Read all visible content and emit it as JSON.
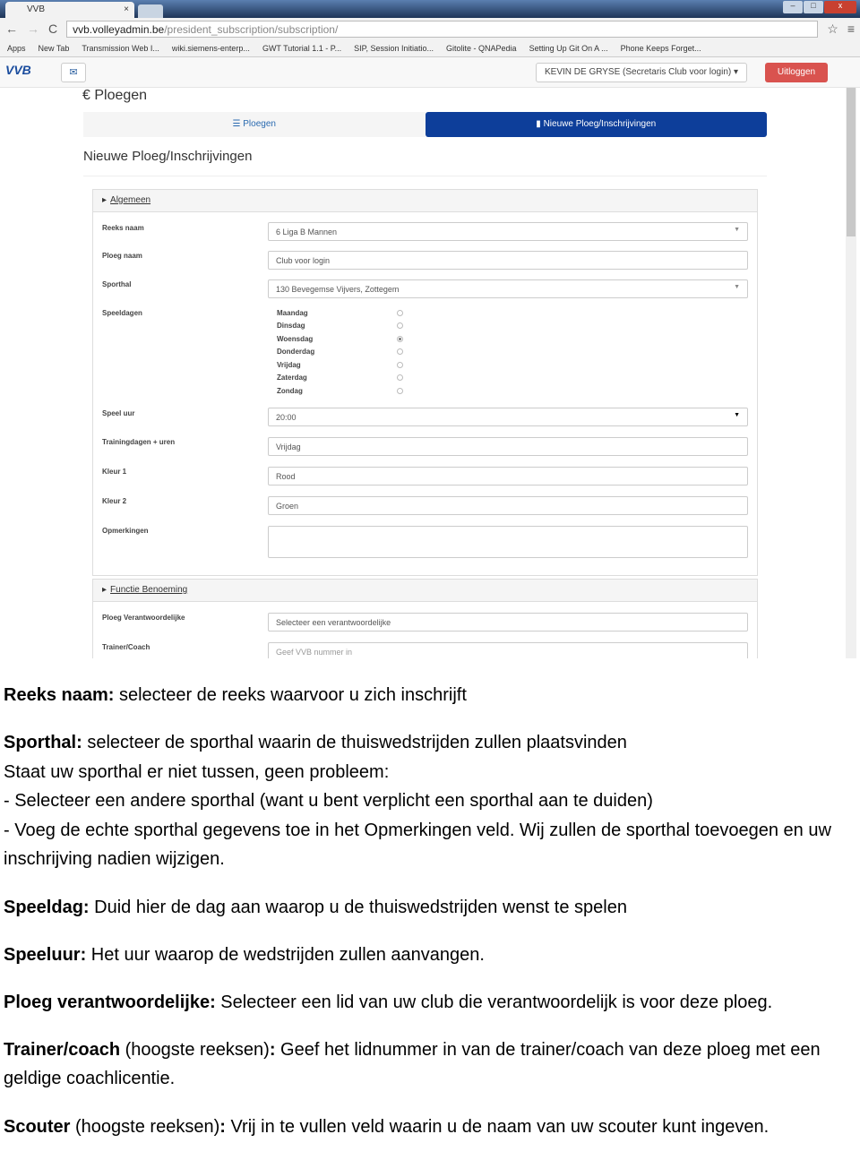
{
  "browser": {
    "tab_title": "VVB",
    "url_host": "vvb.volleyadmin.be",
    "url_path": "/president_subscription/subscription/",
    "bookmarks": [
      "Apps",
      "New Tab",
      "Transmission Web I...",
      "wiki.siemens-enterp...",
      "GWT Tutorial 1.1 - P...",
      "SIP, Session Initiatio...",
      "Gitolite - QNAPedia",
      "Setting Up Git On A ...",
      "Phone Keeps Forget..."
    ]
  },
  "app": {
    "logo": "VVB",
    "user": "KEVIN DE GRYSE (Secretaris Club voor login) ▾",
    "logout": "Uitloggen",
    "page_title": "€ Ploegen",
    "tabs": [
      {
        "label": "☰ Ploegen"
      },
      {
        "label": "▮ Nieuwe Ploeg/Inschrijvingen"
      }
    ],
    "section_title": "Nieuwe Ploeg/Inschrijvingen",
    "panel1": {
      "title": "Algemeen",
      "reeks_label": "Reeks naam",
      "reeks_value": "6 Liga B Mannen",
      "ploeg_label": "Ploeg naam",
      "ploeg_value": "Club voor login",
      "sporthal_label": "Sporthal",
      "sporthal_value": "130 Bevegemse Vijvers, Zottegem",
      "speeldagen_label": "Speeldagen",
      "days": [
        "Maandag",
        "Dinsdag",
        "Woensdag",
        "Donderdag",
        "Vrijdag",
        "Zaterdag",
        "Zondag"
      ],
      "selected_day": "Woensdag",
      "speeluur_label": "Speel uur",
      "speeluur_value": "20:00",
      "training_label": "Trainingdagen + uren",
      "training_value": "Vrijdag",
      "kleur1_label": "Kleur 1",
      "kleur1_value": "Rood",
      "kleur2_label": "Kleur 2",
      "kleur2_value": "Groen",
      "opm_label": "Opmerkingen",
      "opm_value": ""
    },
    "panel2": {
      "title": "Functie Benoeming",
      "verantw_label": "Ploeg Verantwoordelijke",
      "verantw_value": "Selecteer een verantwoordelijke",
      "trainer_label": "Trainer/Coach",
      "trainer_placeholder": "Geef VVB nummer in"
    }
  },
  "doc": {
    "p1_b": "Reeks naam:",
    "p1": " selecteer de reeks waarvoor u zich inschrijft",
    "p2_b": "Sporthal:",
    "p2": " selecteer de sporthal waarin de thuiswedstrijden zullen plaatsvinden",
    "p2_l2": "Staat uw sporthal er niet tussen, geen probleem:",
    "p2_l3": "- Selecteer een andere sporthal (want u bent verplicht een sporthal aan te duiden)",
    "p2_l4": "- Voeg de echte sporthal gegevens toe in het Opmerkingen veld. Wij zullen de sporthal toevoegen en uw inschrijving nadien wijzigen.",
    "p3_b": "Speeldag:",
    "p3": " Duid hier de dag aan waarop u de thuiswedstrijden wenst te spelen",
    "p4_b": "Speeluur:",
    "p4": " Het uur waarop de wedstrijden zullen aanvangen.",
    "p5_b": "Ploeg verantwoordelijke:",
    "p5": " Selecteer een lid van uw club die verantwoordelijk is voor deze ploeg.",
    "p6_b": "Trainer/coach",
    "p6_m": " (hoogste reeksen)",
    "p6_c": ":",
    "p6": " Geef het lidnummer in van de trainer/coach van deze ploeg met een geldige coachlicentie.",
    "p7_b": "Scouter",
    "p7_m": " (hoogste reeksen)",
    "p7_c": ":",
    "p7": " Vrij in te vullen veld waarin u de naam van uw scouter kunt ingeven."
  }
}
